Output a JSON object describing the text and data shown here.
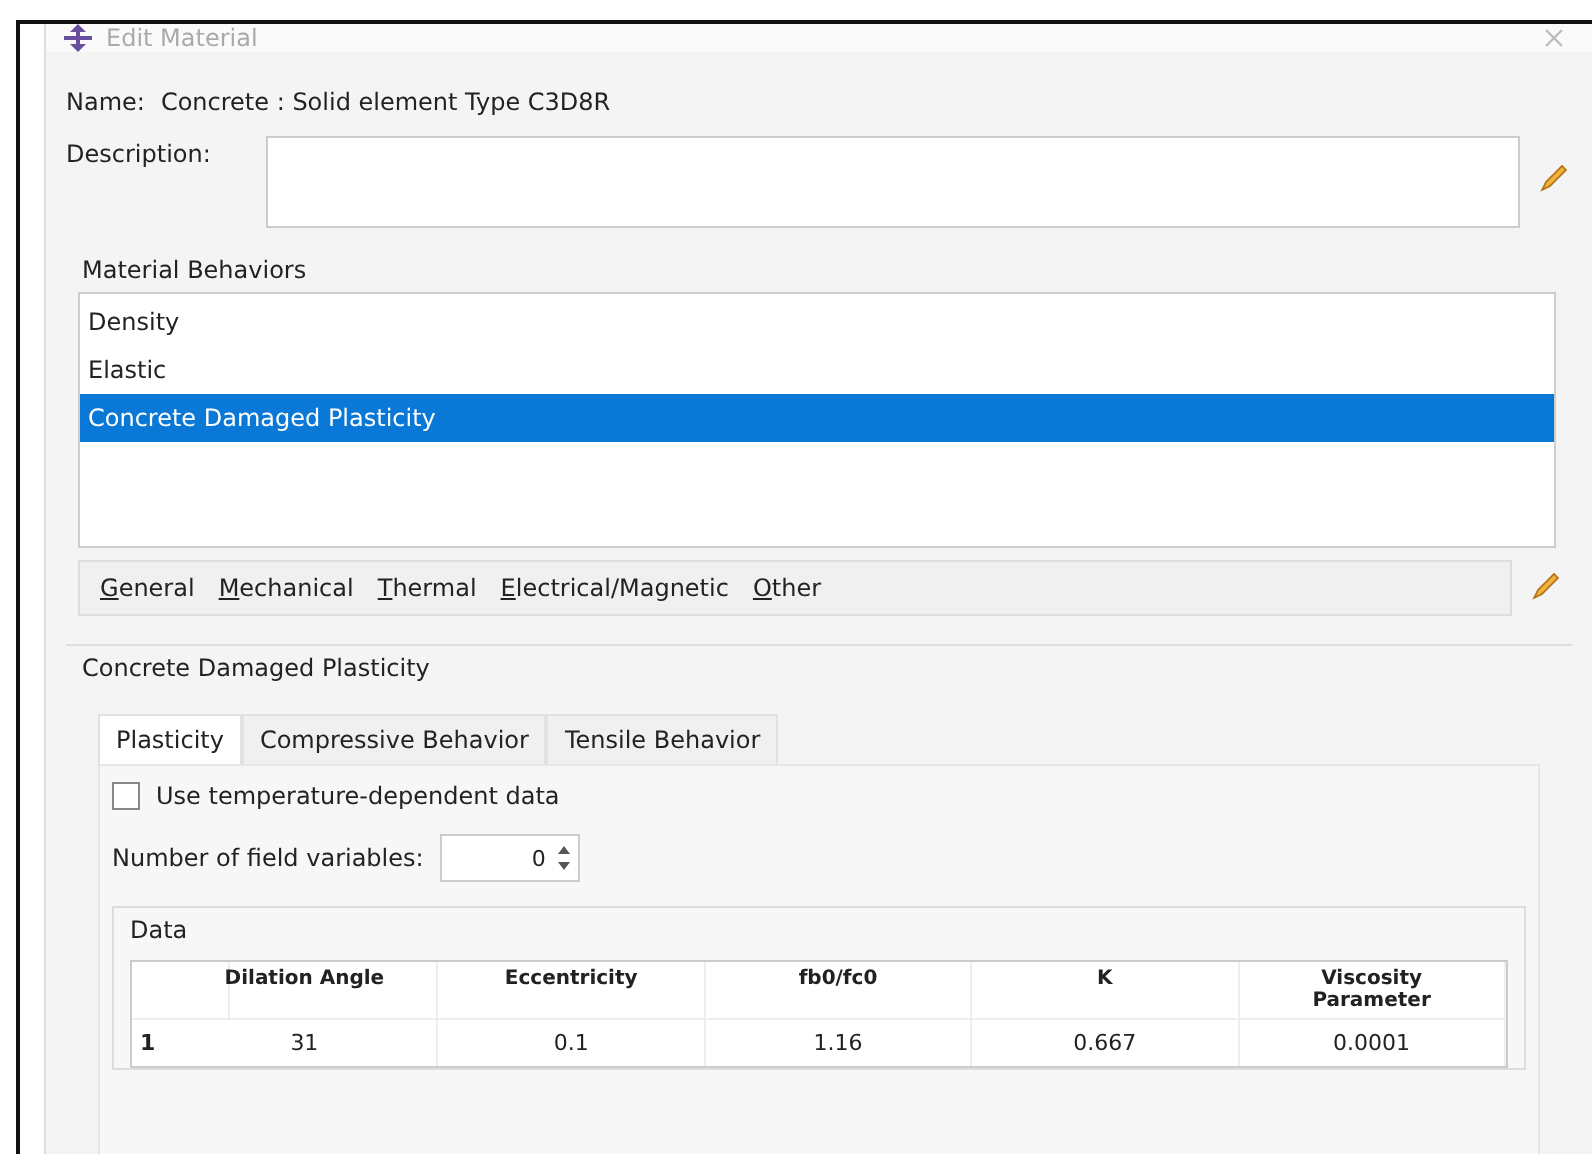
{
  "window": {
    "title": "Edit Material"
  },
  "name_row": {
    "label": "Name:",
    "value": "Concrete : Solid element Type C3D8R"
  },
  "description": {
    "label": "Description:"
  },
  "behaviors": {
    "title": "Material Behaviors",
    "items": [
      {
        "label": "Density",
        "selected": false
      },
      {
        "label": "Elastic",
        "selected": false
      },
      {
        "label": "Concrete Damaged Plasticity",
        "selected": true
      }
    ]
  },
  "menus": [
    {
      "label": "General"
    },
    {
      "label": "Mechanical"
    },
    {
      "label": "Thermal"
    },
    {
      "label": "Electrical/Magnetic"
    },
    {
      "label": "Other"
    }
  ],
  "section": {
    "title": "Concrete Damaged Plasticity",
    "tabs": [
      {
        "label": "Plasticity",
        "selected": true
      },
      {
        "label": "Compressive Behavior",
        "selected": false
      },
      {
        "label": "Tensile Behavior",
        "selected": false
      }
    ],
    "temperature_dependent": {
      "label": "Use temperature-dependent data",
      "checked": false
    },
    "field_variables": {
      "label": "Number of field variables:",
      "value": "0"
    },
    "data": {
      "title": "Data",
      "columns": [
        "Dilation Angle",
        "Eccentricity",
        "fb0/fc0",
        "K",
        "Viscosity Parameter"
      ],
      "rows": [
        {
          "index": "1",
          "cells": [
            "31",
            "0.1",
            "1.16",
            "0.667",
            "0.0001"
          ]
        }
      ]
    }
  }
}
